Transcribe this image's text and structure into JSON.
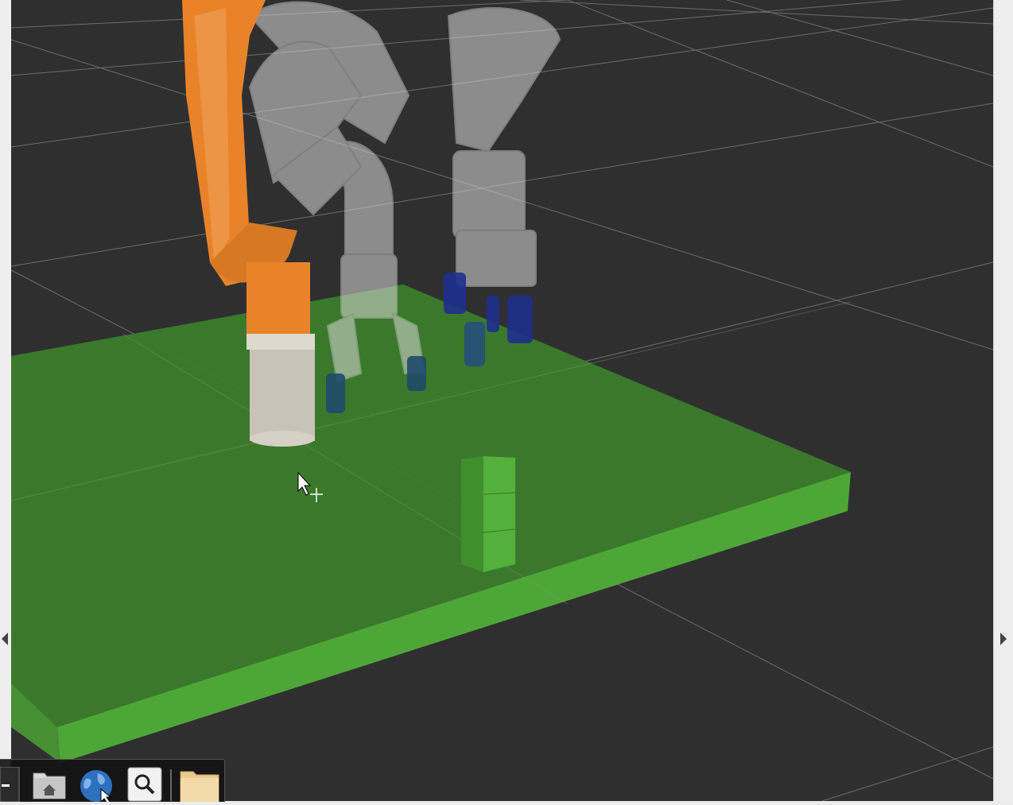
{
  "window": {
    "panel_left_arrow": "◀",
    "panel_right_arrow": "▶"
  },
  "viewport": {
    "background_color": "#2f2f30",
    "grid_color": "#7a7a7a",
    "table_color": "#3b7d2b",
    "table_edge_color": "#4fa638",
    "robot_primary_color": "#e8832a",
    "robot_ghost_color": "#d8d8d8",
    "finger_color": "#1f2f8c"
  },
  "dock": {
    "items": [
      {
        "name": "minimize-icon"
      },
      {
        "name": "folder-home-icon"
      },
      {
        "name": "web-browser-icon"
      },
      {
        "name": "search-icon"
      },
      {
        "name": "file-manager-icon"
      }
    ]
  }
}
